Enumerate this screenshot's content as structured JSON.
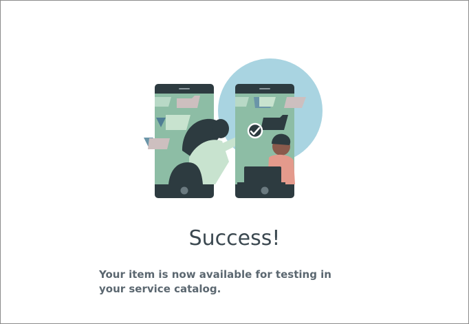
{
  "dialog": {
    "title": "Success!",
    "message": "Your item is now available for testing in your service catalog."
  },
  "illustration": {
    "icon": "success-phones-illustration",
    "colors": {
      "circle": "#a9d4e1",
      "screen": "#8dbda5",
      "phone_frame": "#2d3b40",
      "accent_pink": "#e49a8c",
      "check_badge": "#ffffff"
    }
  }
}
